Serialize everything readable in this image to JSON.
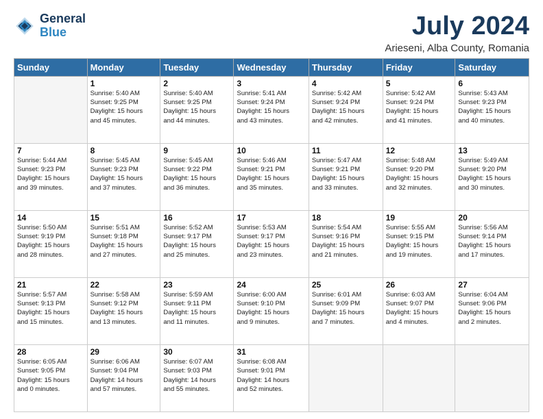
{
  "logo": {
    "line1": "General",
    "line2": "Blue"
  },
  "title": "July 2024",
  "subtitle": "Arieseni, Alba County, Romania",
  "headers": [
    "Sunday",
    "Monday",
    "Tuesday",
    "Wednesday",
    "Thursday",
    "Friday",
    "Saturday"
  ],
  "weeks": [
    [
      {
        "day": "",
        "info": ""
      },
      {
        "day": "1",
        "info": "Sunrise: 5:40 AM\nSunset: 9:25 PM\nDaylight: 15 hours\nand 45 minutes."
      },
      {
        "day": "2",
        "info": "Sunrise: 5:40 AM\nSunset: 9:25 PM\nDaylight: 15 hours\nand 44 minutes."
      },
      {
        "day": "3",
        "info": "Sunrise: 5:41 AM\nSunset: 9:24 PM\nDaylight: 15 hours\nand 43 minutes."
      },
      {
        "day": "4",
        "info": "Sunrise: 5:42 AM\nSunset: 9:24 PM\nDaylight: 15 hours\nand 42 minutes."
      },
      {
        "day": "5",
        "info": "Sunrise: 5:42 AM\nSunset: 9:24 PM\nDaylight: 15 hours\nand 41 minutes."
      },
      {
        "day": "6",
        "info": "Sunrise: 5:43 AM\nSunset: 9:23 PM\nDaylight: 15 hours\nand 40 minutes."
      }
    ],
    [
      {
        "day": "7",
        "info": "Sunrise: 5:44 AM\nSunset: 9:23 PM\nDaylight: 15 hours\nand 39 minutes."
      },
      {
        "day": "8",
        "info": "Sunrise: 5:45 AM\nSunset: 9:23 PM\nDaylight: 15 hours\nand 37 minutes."
      },
      {
        "day": "9",
        "info": "Sunrise: 5:45 AM\nSunset: 9:22 PM\nDaylight: 15 hours\nand 36 minutes."
      },
      {
        "day": "10",
        "info": "Sunrise: 5:46 AM\nSunset: 9:21 PM\nDaylight: 15 hours\nand 35 minutes."
      },
      {
        "day": "11",
        "info": "Sunrise: 5:47 AM\nSunset: 9:21 PM\nDaylight: 15 hours\nand 33 minutes."
      },
      {
        "day": "12",
        "info": "Sunrise: 5:48 AM\nSunset: 9:20 PM\nDaylight: 15 hours\nand 32 minutes."
      },
      {
        "day": "13",
        "info": "Sunrise: 5:49 AM\nSunset: 9:20 PM\nDaylight: 15 hours\nand 30 minutes."
      }
    ],
    [
      {
        "day": "14",
        "info": "Sunrise: 5:50 AM\nSunset: 9:19 PM\nDaylight: 15 hours\nand 28 minutes."
      },
      {
        "day": "15",
        "info": "Sunrise: 5:51 AM\nSunset: 9:18 PM\nDaylight: 15 hours\nand 27 minutes."
      },
      {
        "day": "16",
        "info": "Sunrise: 5:52 AM\nSunset: 9:17 PM\nDaylight: 15 hours\nand 25 minutes."
      },
      {
        "day": "17",
        "info": "Sunrise: 5:53 AM\nSunset: 9:17 PM\nDaylight: 15 hours\nand 23 minutes."
      },
      {
        "day": "18",
        "info": "Sunrise: 5:54 AM\nSunset: 9:16 PM\nDaylight: 15 hours\nand 21 minutes."
      },
      {
        "day": "19",
        "info": "Sunrise: 5:55 AM\nSunset: 9:15 PM\nDaylight: 15 hours\nand 19 minutes."
      },
      {
        "day": "20",
        "info": "Sunrise: 5:56 AM\nSunset: 9:14 PM\nDaylight: 15 hours\nand 17 minutes."
      }
    ],
    [
      {
        "day": "21",
        "info": "Sunrise: 5:57 AM\nSunset: 9:13 PM\nDaylight: 15 hours\nand 15 minutes."
      },
      {
        "day": "22",
        "info": "Sunrise: 5:58 AM\nSunset: 9:12 PM\nDaylight: 15 hours\nand 13 minutes."
      },
      {
        "day": "23",
        "info": "Sunrise: 5:59 AM\nSunset: 9:11 PM\nDaylight: 15 hours\nand 11 minutes."
      },
      {
        "day": "24",
        "info": "Sunrise: 6:00 AM\nSunset: 9:10 PM\nDaylight: 15 hours\nand 9 minutes."
      },
      {
        "day": "25",
        "info": "Sunrise: 6:01 AM\nSunset: 9:09 PM\nDaylight: 15 hours\nand 7 minutes."
      },
      {
        "day": "26",
        "info": "Sunrise: 6:03 AM\nSunset: 9:07 PM\nDaylight: 15 hours\nand 4 minutes."
      },
      {
        "day": "27",
        "info": "Sunrise: 6:04 AM\nSunset: 9:06 PM\nDaylight: 15 hours\nand 2 minutes."
      }
    ],
    [
      {
        "day": "28",
        "info": "Sunrise: 6:05 AM\nSunset: 9:05 PM\nDaylight: 15 hours\nand 0 minutes."
      },
      {
        "day": "29",
        "info": "Sunrise: 6:06 AM\nSunset: 9:04 PM\nDaylight: 14 hours\nand 57 minutes."
      },
      {
        "day": "30",
        "info": "Sunrise: 6:07 AM\nSunset: 9:03 PM\nDaylight: 14 hours\nand 55 minutes."
      },
      {
        "day": "31",
        "info": "Sunrise: 6:08 AM\nSunset: 9:01 PM\nDaylight: 14 hours\nand 52 minutes."
      },
      {
        "day": "",
        "info": ""
      },
      {
        "day": "",
        "info": ""
      },
      {
        "day": "",
        "info": ""
      }
    ]
  ]
}
